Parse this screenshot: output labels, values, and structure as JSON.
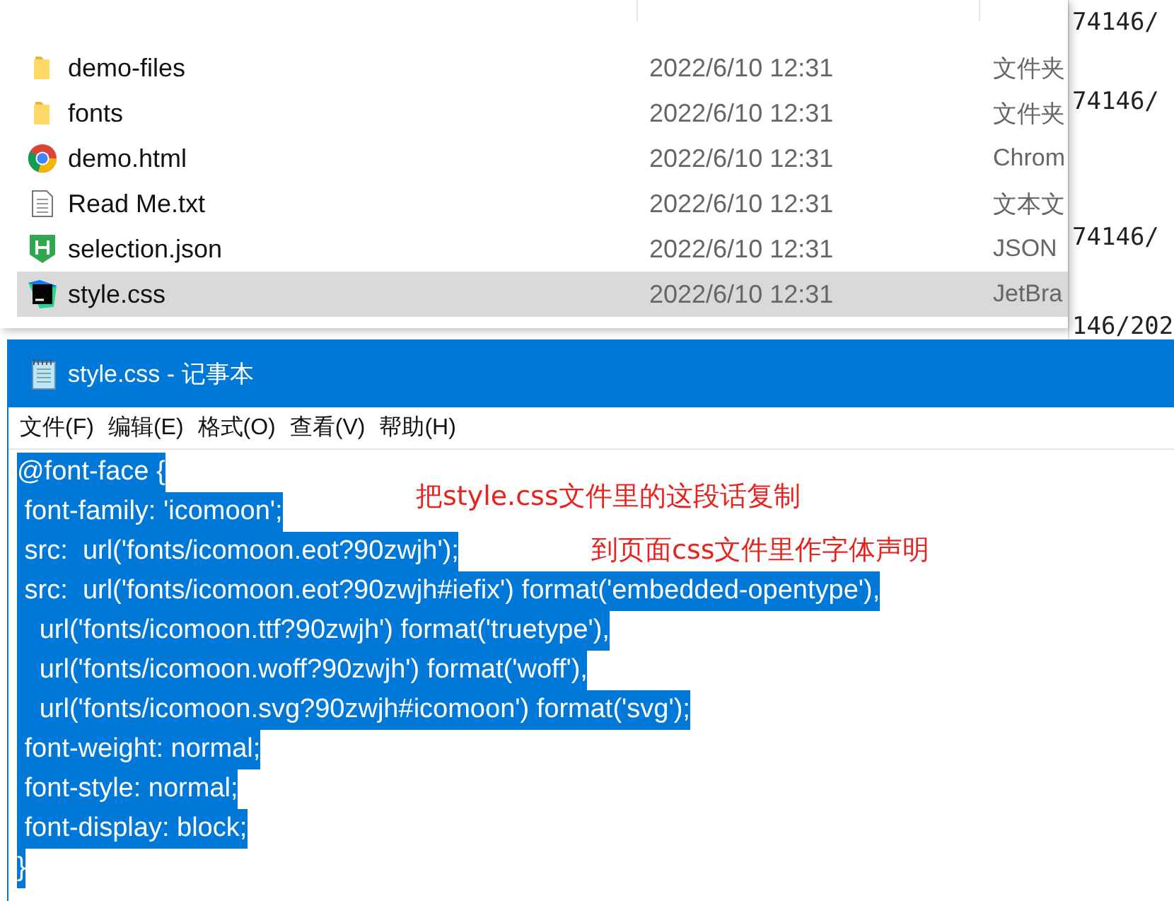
{
  "explorer": {
    "files": [
      {
        "name": "demo-files",
        "date": "2022/6/10 12:31",
        "type": "文件夹",
        "kind": "folder",
        "selected": false
      },
      {
        "name": "fonts",
        "date": "2022/6/10 12:31",
        "type": "文件夹",
        "kind": "folder",
        "selected": false
      },
      {
        "name": "demo.html",
        "date": "2022/6/10 12:31",
        "type": "Chrom",
        "kind": "chrome",
        "selected": false
      },
      {
        "name": "Read Me.txt",
        "date": "2022/6/10 12:31",
        "type": "文本文",
        "kind": "text",
        "selected": false
      },
      {
        "name": "selection.json",
        "date": "2022/6/10 12:31",
        "type": "JSON",
        "kind": "hbuilder",
        "selected": false
      },
      {
        "name": "style.css",
        "date": "2022/6/10 12:31",
        "type": "JetBra",
        "kind": "webstorm",
        "selected": true
      }
    ]
  },
  "background_window": {
    "lines": [
      "74146/",
      "74146/",
      "74146/",
      "146/202"
    ]
  },
  "notepad": {
    "title": "style.css - 记事本",
    "menu": [
      "文件(F)",
      "编辑(E)",
      "格式(O)",
      "查看(V)",
      "帮助(H)"
    ],
    "lines": [
      {
        "text": "@font-face {",
        "selected": true
      },
      {
        "text": " font-family: 'icomoon';",
        "selected": true
      },
      {
        "text": " src:  url('fonts/icomoon.eot?90zwjh');",
        "selected": true
      },
      {
        "text": " src:  url('fonts/icomoon.eot?90zwjh#iefix') format('embedded-opentype'),",
        "selected": true
      },
      {
        "text": "   url('fonts/icomoon.ttf?90zwjh') format('truetype'),",
        "selected": true
      },
      {
        "text": "   url('fonts/icomoon.woff?90zwjh') format('woff'),",
        "selected": true
      },
      {
        "text": "   url('fonts/icomoon.svg?90zwjh#icomoon') format('svg');",
        "selected": true
      },
      {
        "text": " font-weight: normal;",
        "selected": true
      },
      {
        "text": " font-style: normal;",
        "selected": true
      },
      {
        "text": " font-display: block;",
        "selected": true
      },
      {
        "text": "}",
        "selected": true
      }
    ],
    "annotations": [
      "把style.css文件里的这段话复制",
      "到页面css文件里作字体声明"
    ]
  }
}
